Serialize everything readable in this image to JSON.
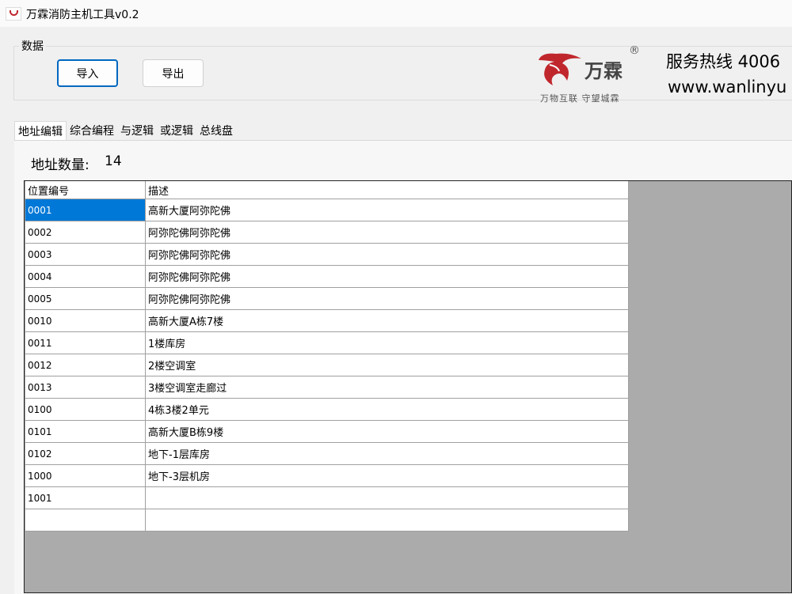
{
  "window": {
    "title": "万霖消防主机工具v0.2"
  },
  "data_group": {
    "label": "数据",
    "import_label": "导入",
    "export_label": "导出"
  },
  "brand": {
    "name": "万霖",
    "registered": "®",
    "slogan": "万物互联 守望城霖",
    "hotline": "服务热线 4006",
    "website": "www.wanlinyu",
    "color": "#c0272d"
  },
  "tabs": [
    "地址编辑",
    "综合编程",
    "与逻辑",
    "或逻辑",
    "总线盘"
  ],
  "active_tab": "地址编辑",
  "address": {
    "count_label": "地址数量:",
    "count_value": "14"
  },
  "table": {
    "columns": [
      "位置编号",
      "描述"
    ],
    "rows": [
      [
        "0001",
        "高新大厦阿弥陀佛"
      ],
      [
        "0002",
        "阿弥陀佛阿弥陀佛"
      ],
      [
        "0003",
        "阿弥陀佛阿弥陀佛"
      ],
      [
        "0004",
        "阿弥陀佛阿弥陀佛"
      ],
      [
        "0005",
        "阿弥陀佛阿弥陀佛"
      ],
      [
        "0010",
        "高新大厦A栋7楼"
      ],
      [
        "0011",
        "1楼库房"
      ],
      [
        "0012",
        "2楼空调室"
      ],
      [
        "0013",
        "3楼空调室走廊过"
      ],
      [
        "0100",
        "4栋3楼2单元"
      ],
      [
        "0101",
        "高新大厦B栋9楼"
      ],
      [
        "0102",
        "地下-1层库房"
      ],
      [
        "1000",
        "地下-3层机房"
      ],
      [
        "1001",
        ""
      ],
      [
        "",
        ""
      ]
    ],
    "selected_row": 0
  },
  "colors": {
    "selection": "#0078d7",
    "grid_background": "#ababab",
    "primary_border": "#0067c0"
  }
}
